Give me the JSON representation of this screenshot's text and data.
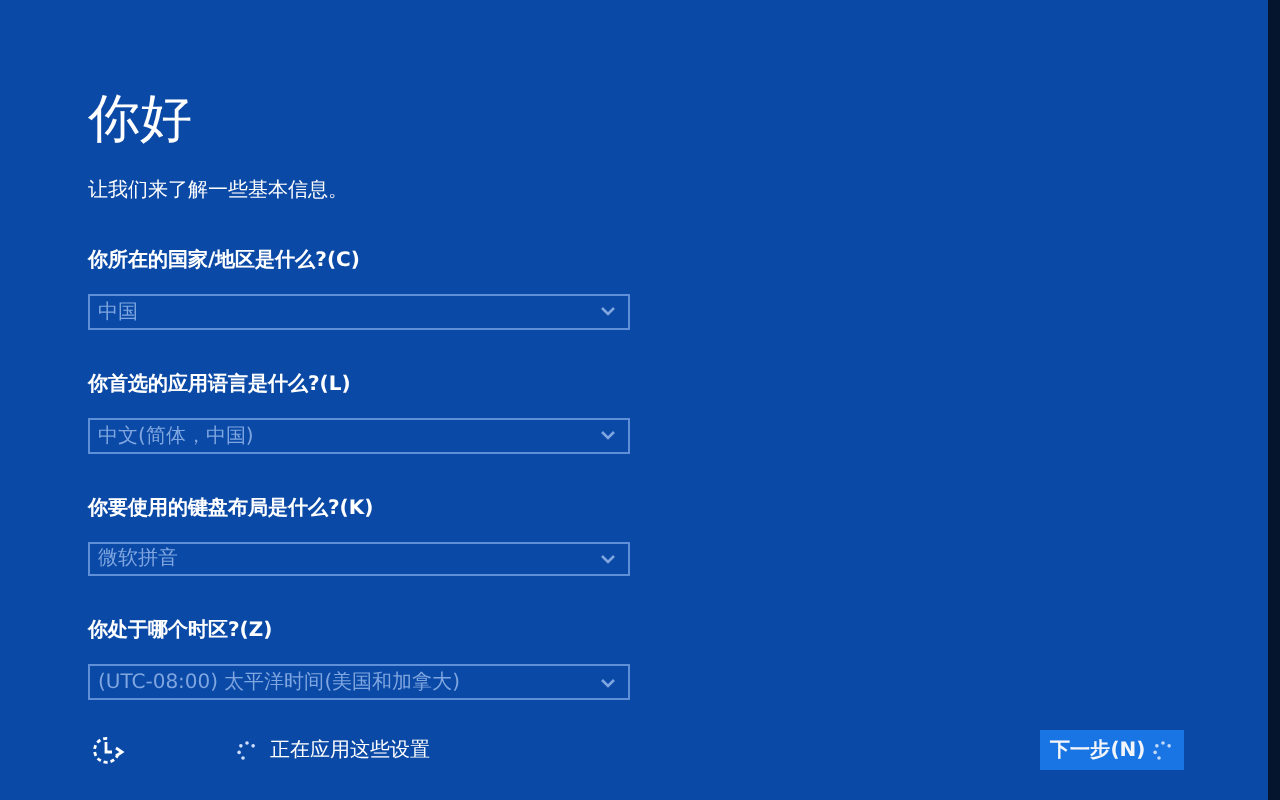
{
  "title": "你好",
  "subtitle": "让我们来了解一些基本信息。",
  "questions": [
    {
      "label": "你所在的国家/地区是什么?(C)",
      "value": "中国",
      "disabled": true
    },
    {
      "label": "你首选的应用语言是什么?(L)",
      "value": "中文(简体，中国)",
      "disabled": true
    },
    {
      "label": "你要使用的键盘布局是什么?(K)",
      "value": "微软拼音",
      "disabled": true
    },
    {
      "label": "你处于哪个时区?(Z)",
      "value": "(UTC-08:00) 太平洋时间(美国和加拿大)",
      "disabled": true
    }
  ],
  "status": "正在应用这些设置",
  "next_button": {
    "label": "下一步(N)",
    "busy": true
  }
}
